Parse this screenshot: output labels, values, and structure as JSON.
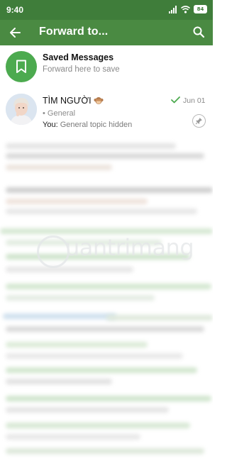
{
  "status": {
    "time": "9:40",
    "battery": "84"
  },
  "appbar": {
    "title": "Forward to..."
  },
  "saved": {
    "title": "Saved Messages",
    "subtitle": "Forward here to save"
  },
  "chat": {
    "name": "TÌM NGƯỜI",
    "topic": "• General",
    "sender": "You:",
    "preview": "General topic hidden",
    "date": "Jun 01"
  },
  "watermark": {
    "text": "uantrimang"
  },
  "colors": {
    "status_bar": "#3f7d3a",
    "app_bar": "#4a8a42",
    "accent": "#4caa4f"
  }
}
